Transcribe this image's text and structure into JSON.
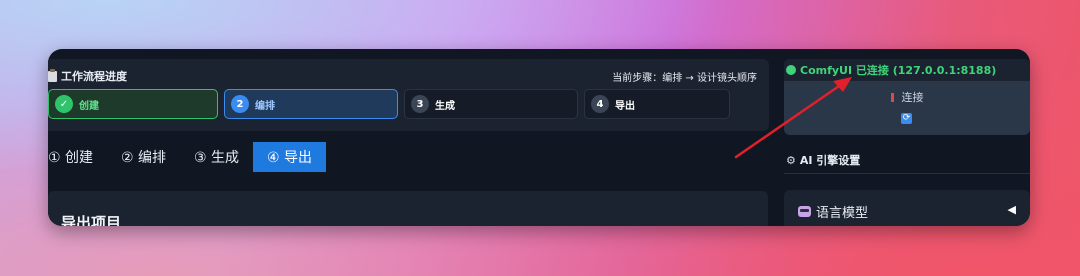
{
  "progress": {
    "title": "工作流程进度",
    "current_step": "当前步骤：编排 → 设计镜头顺序",
    "steps": [
      {
        "num": "✓",
        "label": "创建",
        "state": "done"
      },
      {
        "num": "2",
        "label": "编排",
        "state": "active"
      },
      {
        "num": "3",
        "label": "生成",
        "state": "todo"
      },
      {
        "num": "4",
        "label": "导出",
        "state": "todo"
      }
    ]
  },
  "tabs": [
    {
      "label": "① 创建"
    },
    {
      "label": "② 编排"
    },
    {
      "label": "③ 生成"
    },
    {
      "label": "④ 导出",
      "active": true
    }
  ],
  "export": {
    "title": "导出项目"
  },
  "connection": {
    "status": "ComfyUI 已连接 (127.0.0.1:8188)",
    "connect_label": "连接",
    "refresh_icon": "refresh-icon",
    "status_color": "#3fd47a"
  },
  "ai_engine": {
    "title": "AI 引擎设置"
  },
  "language_model": {
    "label": "语言模型",
    "collapse_glyph": "◀"
  },
  "colors": {
    "accent": "#1f7ae0",
    "success": "#2fc46b",
    "annotation_arrow": "#e0202a"
  }
}
